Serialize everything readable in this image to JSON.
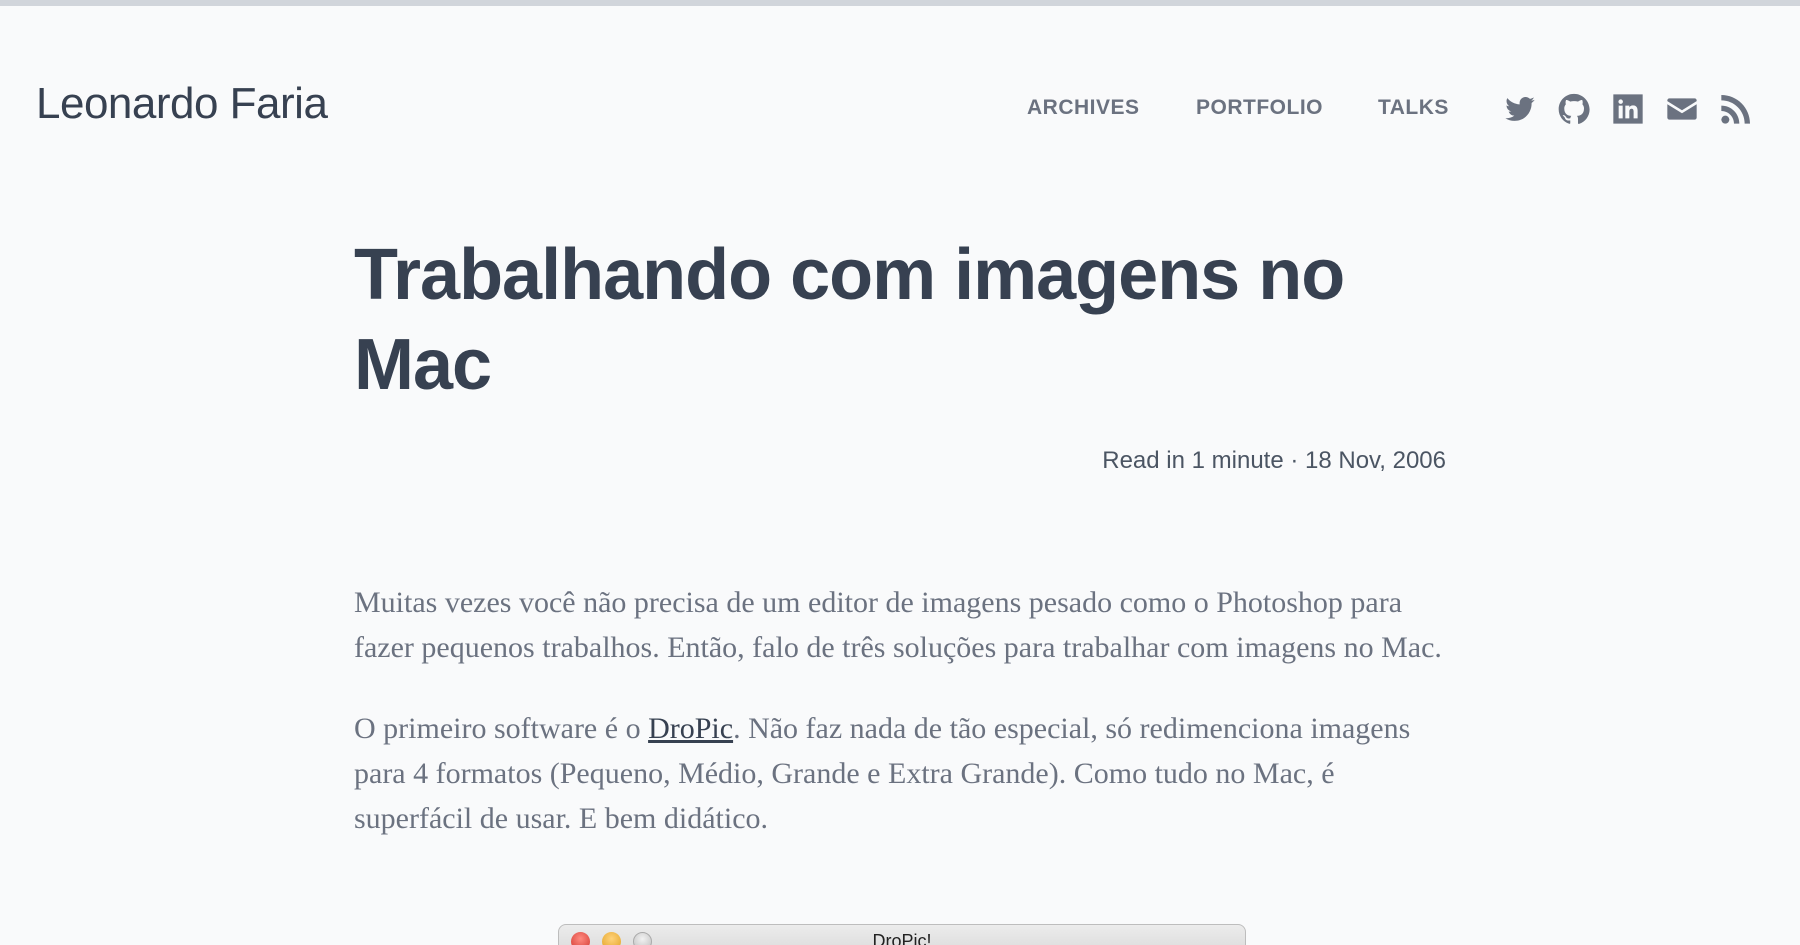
{
  "site": {
    "title": "Leonardo Faria"
  },
  "nav": {
    "items": [
      {
        "label": "ARCHIVES"
      },
      {
        "label": "PORTFOLIO"
      },
      {
        "label": "TALKS"
      }
    ],
    "social": [
      {
        "icon": "twitter-icon"
      },
      {
        "icon": "github-icon"
      },
      {
        "icon": "linkedin-icon"
      },
      {
        "icon": "email-icon"
      },
      {
        "icon": "rss-icon"
      }
    ]
  },
  "post": {
    "title": "Trabalhando com imagens no Mac",
    "meta": "Read in 1 minute · 18 Nov, 2006",
    "paragraph1": "Muitas vezes você não precisa de um editor de imagens pesado como o Photoshop para fazer pequenos trabalhos. Então, falo de três soluções para trabalhar com imagens no Mac.",
    "paragraph2_before": "O primeiro software é o ",
    "paragraph2_link": "DroPic",
    "paragraph2_after": ". Não faz nada de tão especial, só redimenciona imagens para 4 formatos (Pequeno, Médio, Grande e Extra Grande). Como tudo no Mac, é superfácil de usar. E bem didático.",
    "image_window_title": "DroPic!"
  },
  "colors": {
    "background": "#f9fafb",
    "text_dark": "#374151",
    "text_muted": "#6b7280",
    "top_bar": "#d1d5db"
  }
}
